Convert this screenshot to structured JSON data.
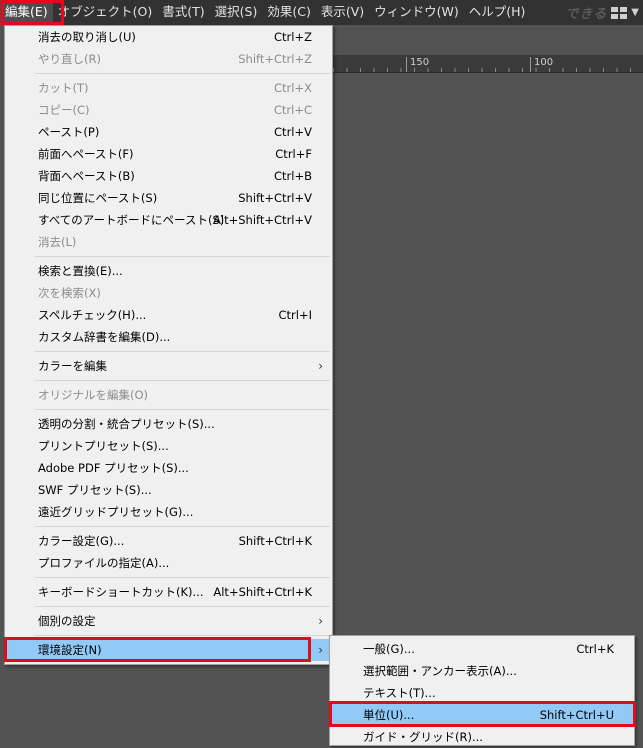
{
  "menubar": {
    "items": [
      {
        "label": "編集(E)"
      },
      {
        "label": "オブジェクト(O)"
      },
      {
        "label": "書式(T)"
      },
      {
        "label": "選択(S)"
      },
      {
        "label": "効果(C)"
      },
      {
        "label": "表示(V)"
      },
      {
        "label": "ウィンドウ(W)"
      },
      {
        "label": "ヘルプ(H)"
      }
    ],
    "watermark": "できる"
  },
  "ruler": {
    "ticks": [
      "150",
      "100"
    ]
  },
  "edit_menu": {
    "undo": {
      "label": "消去の取り消し(U)",
      "shortcut": "Ctrl+Z"
    },
    "redo": {
      "label": "やり直し(R)",
      "shortcut": "Shift+Ctrl+Z"
    },
    "cut": {
      "label": "カット(T)",
      "shortcut": "Ctrl+X"
    },
    "copy": {
      "label": "コピー(C)",
      "shortcut": "Ctrl+C"
    },
    "paste": {
      "label": "ペースト(P)",
      "shortcut": "Ctrl+V"
    },
    "paste_front": {
      "label": "前面へペースト(F)",
      "shortcut": "Ctrl+F"
    },
    "paste_back": {
      "label": "背面へペースト(B)",
      "shortcut": "Ctrl+B"
    },
    "paste_in_place": {
      "label": "同じ位置にペースト(S)",
      "shortcut": "Shift+Ctrl+V"
    },
    "paste_all_artboards": {
      "label": "すべてのアートボードにペースト(S)",
      "shortcut": "Alt+Shift+Ctrl+V"
    },
    "clear": {
      "label": "消去(L)"
    },
    "find_replace": {
      "label": "検索と置換(E)..."
    },
    "find_next": {
      "label": "次を検索(X)"
    },
    "spell_check": {
      "label": "スペルチェック(H)...",
      "shortcut": "Ctrl+I"
    },
    "custom_dictionary": {
      "label": "カスタム辞書を編集(D)..."
    },
    "edit_colors": {
      "label": "カラーを編集"
    },
    "edit_original": {
      "label": "オリジナルを編集(O)"
    },
    "transparency_presets": {
      "label": "透明の分割・統合プリセット(S)..."
    },
    "print_presets": {
      "label": "プリントプリセット(S)..."
    },
    "pdf_presets": {
      "label": "Adobe PDF プリセット(S)..."
    },
    "swf_presets": {
      "label": "SWF プリセット(S)..."
    },
    "perspective_presets": {
      "label": "遠近グリッドプリセット(G)..."
    },
    "color_settings": {
      "label": "カラー設定(G)...",
      "shortcut": "Shift+Ctrl+K"
    },
    "assign_profile": {
      "label": "プロファイルの指定(A)..."
    },
    "keyboard_shortcuts": {
      "label": "キーボードショートカット(K)...",
      "shortcut": "Alt+Shift+Ctrl+K"
    },
    "my_settings": {
      "label": "個別の設定"
    },
    "preferences": {
      "label": "環境設定(N)"
    }
  },
  "preferences_submenu": {
    "general": {
      "label": "一般(G)...",
      "shortcut": "Ctrl+K"
    },
    "selection": {
      "label": "選択範囲・アンカー表示(A)..."
    },
    "type": {
      "label": "テキスト(T)..."
    },
    "units": {
      "label": "単位(U)...",
      "shortcut": "Shift+Ctrl+U"
    },
    "guides": {
      "label": "ガイド・グリッド(R)..."
    }
  },
  "colors": {
    "highlight_box": "#e00b1b",
    "selected_row": "#91c9f7",
    "menubar": "#323232",
    "canvas": "#535353"
  }
}
